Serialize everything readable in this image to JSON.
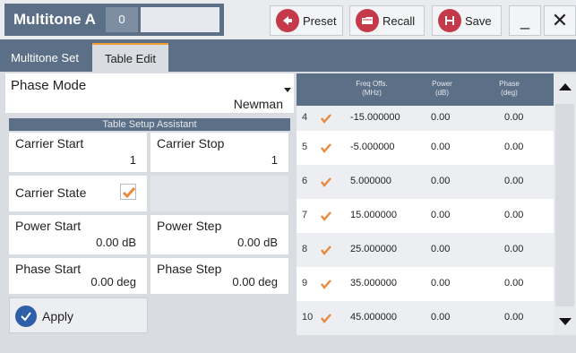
{
  "window": {
    "title": "Multitone A",
    "badge": "0"
  },
  "toolbar": {
    "preset_label": "Preset",
    "recall_label": "Recall",
    "save_label": "Save",
    "minimize_label": "_",
    "close_label": "✕"
  },
  "tabs": [
    {
      "label": "Multitone Set"
    },
    {
      "label": "Table Edit"
    }
  ],
  "phase_mode": {
    "label": "Phase Mode",
    "value": "Newman"
  },
  "setup": {
    "header": "Table Setup Assistant",
    "carrier_start": {
      "label": "Carrier Start",
      "value": "1"
    },
    "carrier_stop": {
      "label": "Carrier Stop",
      "value": "1"
    },
    "carrier_state": {
      "label": "Carrier State",
      "checked": true
    },
    "power_start": {
      "label": "Power Start",
      "value": "0.00 dB"
    },
    "power_step": {
      "label": "Power Step",
      "value": "0.00 dB"
    },
    "phase_start": {
      "label": "Phase Start",
      "value": "0.00 deg"
    },
    "phase_step": {
      "label": "Phase Step",
      "value": "0.00 deg"
    },
    "apply_label": "Apply"
  },
  "table": {
    "headers": {
      "freq": "Freq Offs.",
      "freq_unit": "(MHz)",
      "power": "Power",
      "power_unit": "(dB)",
      "phase": "Phase",
      "phase_unit": "(deg)"
    },
    "rows": [
      {
        "num": "4",
        "freq": "-15.000000",
        "power": "0.00",
        "phase": "0.00"
      },
      {
        "num": "5",
        "freq": "-5.000000",
        "power": "0.00",
        "phase": "0.00"
      },
      {
        "num": "6",
        "freq": "5.000000",
        "power": "0.00",
        "phase": "0.00"
      },
      {
        "num": "7",
        "freq": "15.000000",
        "power": "0.00",
        "phase": "0.00"
      },
      {
        "num": "8",
        "freq": "25.000000",
        "power": "0.00",
        "phase": "0.00"
      },
      {
        "num": "9",
        "freq": "35.000000",
        "power": "0.00",
        "phase": "0.00"
      },
      {
        "num": "10",
        "freq": "45.000000",
        "power": "0.00",
        "phase": "0.00"
      }
    ]
  },
  "colors": {
    "accent": "#5b6f86",
    "check": "#e8893c",
    "icon_red": "#c43a4a",
    "apply_blue": "#2f5fa8"
  }
}
